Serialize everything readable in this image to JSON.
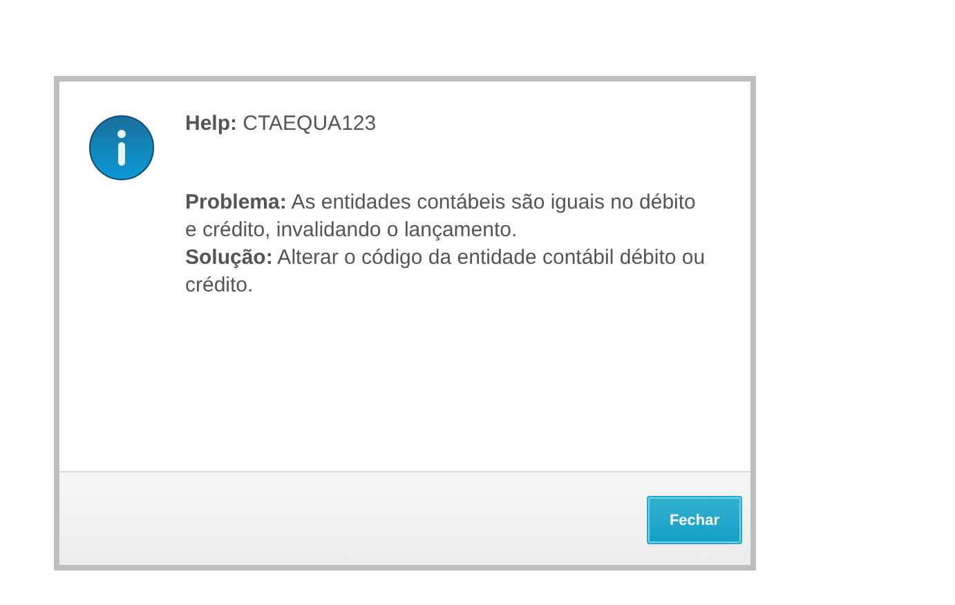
{
  "dialog": {
    "title": "**Help:** CTAEQUA123",
    "paragraphs": [
      "**Problema:** As entidades contábeis são iguais no débito e crédito, invalidando o lançamento.",
      "**Solução:** Alterar o código da entidade contábil débito ou crédito."
    ],
    "buttons": [
      "Fechar"
    ]
  }
}
